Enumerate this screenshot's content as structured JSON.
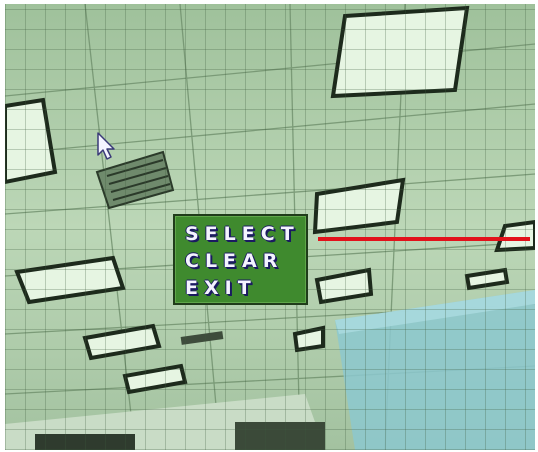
{
  "menu": {
    "items": [
      {
        "label": "SELECT"
      },
      {
        "label": "CLEAR"
      },
      {
        "label": "EXIT"
      }
    ]
  },
  "colors": {
    "menu_background": "#3f8a2e",
    "menu_text": "#f4f4ff",
    "selection_line": "#e2121b",
    "ceiling_tint": "#b8d4b4"
  },
  "icons": {
    "pointer": "mouse-pointer-icon"
  }
}
